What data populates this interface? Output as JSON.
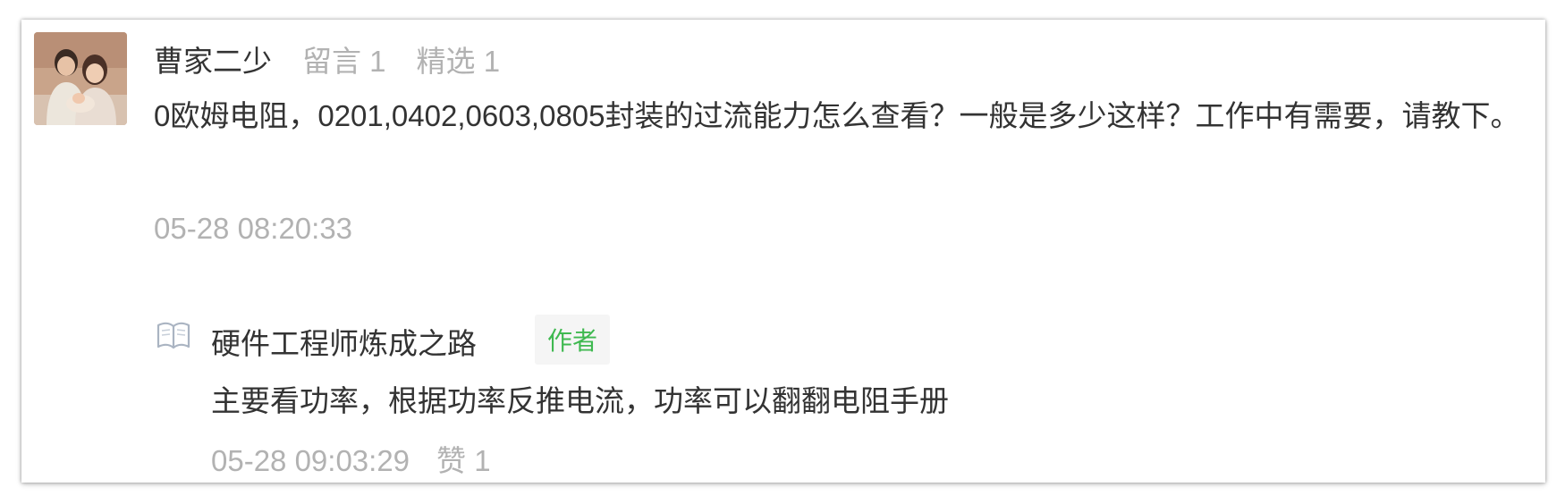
{
  "comment": {
    "username": "曹家二少",
    "message_count_label": "留言 1",
    "featured_count_label": "精选 1",
    "text": "0欧姆电阻，0201,0402,0603,0805封装的过流能力怎么查看？一般是多少这样？工作中有需要，请教下。",
    "timestamp": "05-28 08:20:33"
  },
  "reply": {
    "author_name": "硬件工程师炼成之路",
    "author_badge": "作者",
    "text": "主要看功率，根据功率反推电流，功率可以翻翻电阻手册",
    "timestamp": "05-28 09:03:29",
    "like_label": "赞 1"
  },
  "icons": {
    "reply_icon": "open-book-icon",
    "avatar": "user-avatar-photo"
  },
  "colors": {
    "primary_text": "#333333",
    "secondary_text": "#b2b2b2",
    "author_badge_text": "#3fb950",
    "author_badge_bg": "#f5f5f5"
  }
}
